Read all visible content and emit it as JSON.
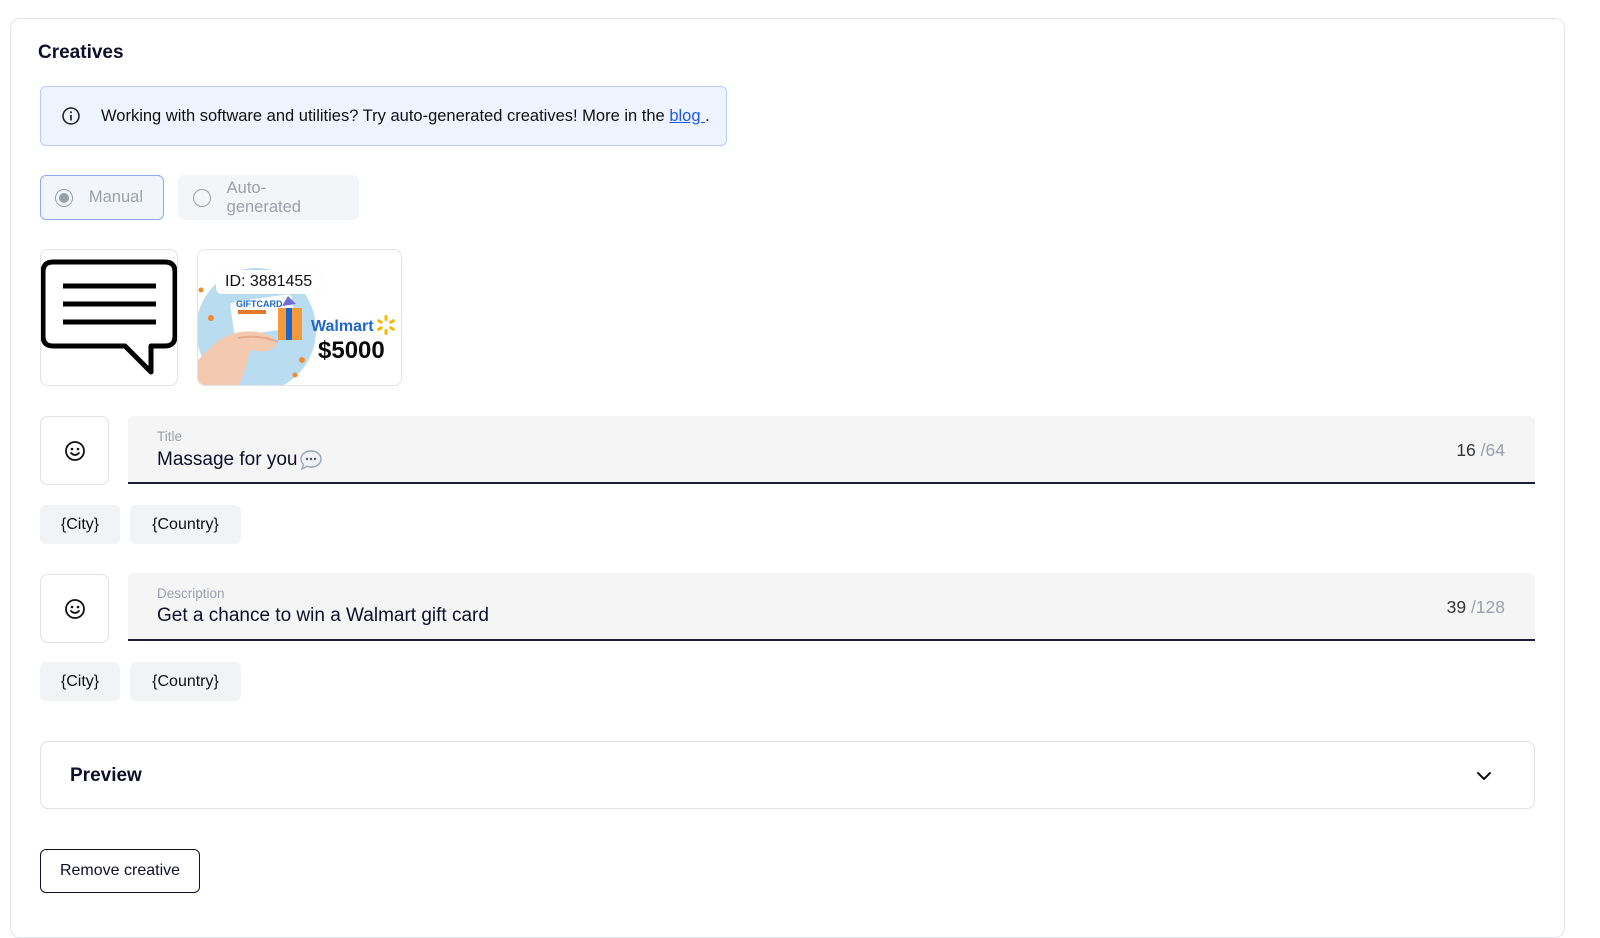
{
  "section": {
    "title": "Creatives"
  },
  "banner": {
    "text": "Working with software and utilities? Try auto-generated creatives! More in the ",
    "link": "blog ",
    "suffix": "."
  },
  "creative_mode": {
    "options": [
      {
        "label": "Manual",
        "selected": true
      },
      {
        "label": "Auto-generated",
        "selected": false
      }
    ]
  },
  "thumbnails": {
    "icon_name": "speech-bubble-icon",
    "image_id_label": "ID: 3881455",
    "image_brand": "Walmart",
    "image_amount": "$5000",
    "image_card_text": "GIFTCARD"
  },
  "title_field": {
    "label": "Title",
    "value": "Massage for you",
    "count": "16",
    "max": "/64"
  },
  "description_field": {
    "label": "Description",
    "value": "Get a chance to win a Walmart gift card",
    "count": "39",
    "max": "/128"
  },
  "macros": {
    "city": "{City}",
    "country": "{Country}"
  },
  "preview": {
    "title": "Preview"
  },
  "actions": {
    "remove_label": "Remove creative"
  },
  "colors": {
    "accent": "#1f5ae0",
    "banner_bg": "#eef3ff",
    "field_underline": "#1c1d36"
  }
}
